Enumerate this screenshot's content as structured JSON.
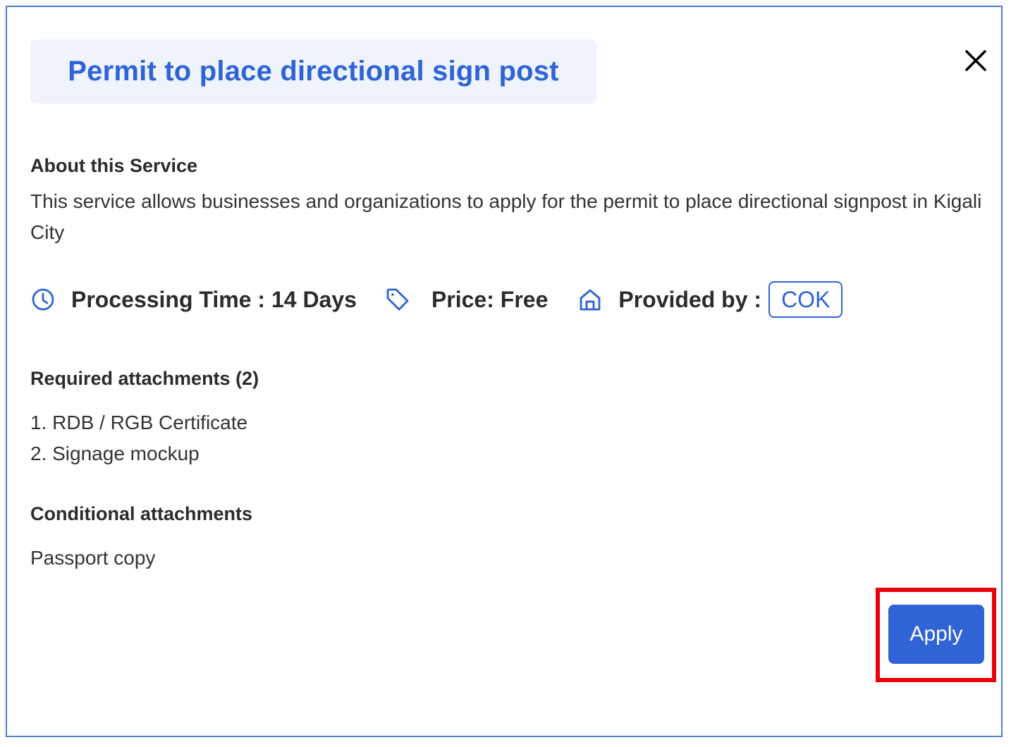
{
  "dialog": {
    "title": "Permit to place directional sign post",
    "close_icon": "close-icon"
  },
  "about": {
    "heading": "About this Service",
    "description": "This service allows businesses and organizations to apply for the permit to place directional signpost in Kigali City"
  },
  "meta": {
    "processing_icon": "clock-icon",
    "processing_time": "Processing Time : 14 Days",
    "price_icon": "tag-icon",
    "price": "Price: Free",
    "provider_icon": "home-icon",
    "provided_by_label": "Provided by :",
    "provider_badge": "COK"
  },
  "required_attachments": {
    "heading": "Required attachments (2)",
    "items": [
      "1. RDB / RGB Certificate",
      "2. Signage mockup"
    ]
  },
  "conditional_attachments": {
    "heading": "Conditional attachments",
    "items": [
      "Passport copy"
    ]
  },
  "actions": {
    "apply_label": "Apply"
  },
  "colors": {
    "accent": "#2f63d6",
    "title_bg": "#eef3fc",
    "highlight": "#e8000d",
    "modal_border": "#4a7fd0"
  }
}
